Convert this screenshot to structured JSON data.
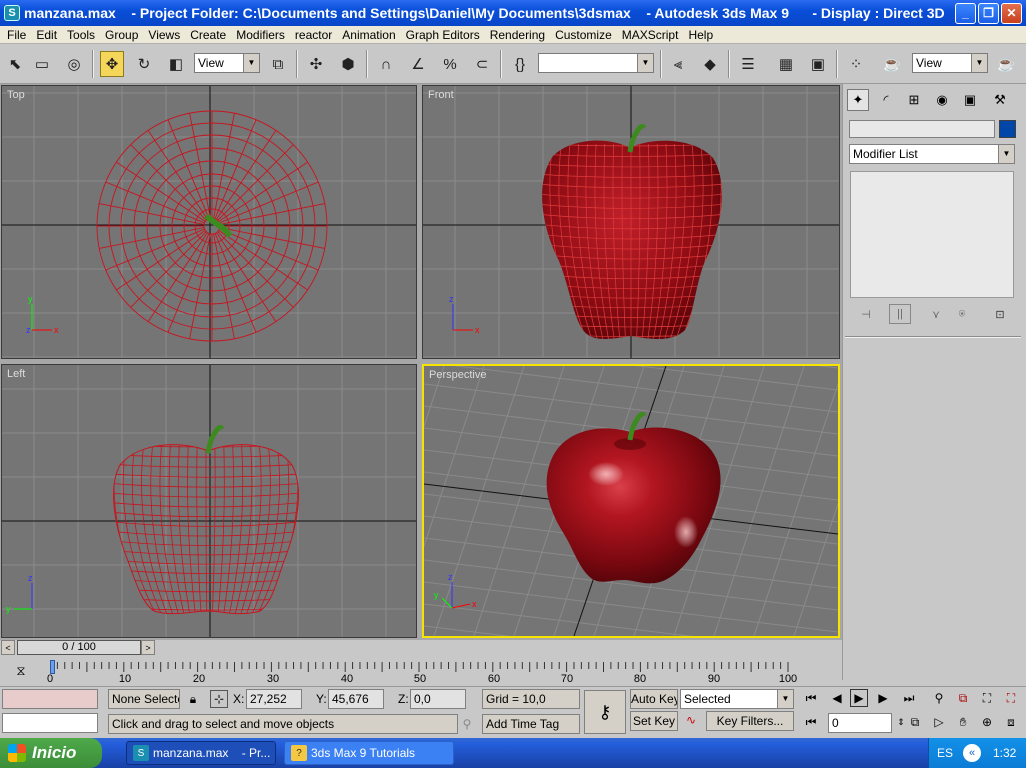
{
  "window": {
    "title": "manzana.max    - Project Folder: C:\\Documents and Settings\\Daniel\\My Documents\\3dsmax    - Autodesk 3ds Max 9      - Display : Direct 3D",
    "min_glyph": "_",
    "max_glyph": "❐",
    "close_glyph": "✕"
  },
  "menu": [
    "File",
    "Edit",
    "Tools",
    "Group",
    "Views",
    "Create",
    "Modifiers",
    "reactor",
    "Animation",
    "Graph Editors",
    "Rendering",
    "Customize",
    "MAXScript",
    "Help"
  ],
  "toolbar": {
    "refcoord_value": "View",
    "named_selection_value": "",
    "render_view_value": "View"
  },
  "viewports": {
    "top": {
      "label": "Top"
    },
    "front": {
      "label": "Front"
    },
    "left": {
      "label": "Left"
    },
    "perspective": {
      "label": "Perspective"
    }
  },
  "axis": {
    "x": "x",
    "y": "y",
    "z": "z"
  },
  "colors": {
    "wire": "#c8141e",
    "stem": "#3d8a1e",
    "active_border": "#f7e300",
    "object_color": "#0046a8"
  },
  "command_panel": {
    "object_name": "",
    "modifier_list": "Modifier List"
  },
  "timeline": {
    "slider_text": "0 / 100",
    "ticks": [
      "0",
      "10",
      "20",
      "30",
      "40",
      "50",
      "60",
      "70",
      "80",
      "90",
      "100"
    ]
  },
  "status": {
    "selection_text": "None Selecte",
    "x_label": "X:",
    "x_value": "27,252",
    "y_label": "Y:",
    "y_value": "45,676",
    "z_label": "Z:",
    "z_value": "0,0",
    "grid": "Grid = 10,0",
    "prompt": "Click and drag to select and move objects",
    "add_time_tag": "Add Time Tag",
    "auto_key": "Auto Key",
    "set_key": "Set Key",
    "selected": "Selected",
    "key_filters": "Key Filters...",
    "frame": "0"
  },
  "taskbar": {
    "start": "Inicio",
    "tasks": [
      "manzana.max    - Pr...",
      "3ds Max 9 Tutorials"
    ],
    "lang": "ES",
    "clock": "1:32"
  }
}
